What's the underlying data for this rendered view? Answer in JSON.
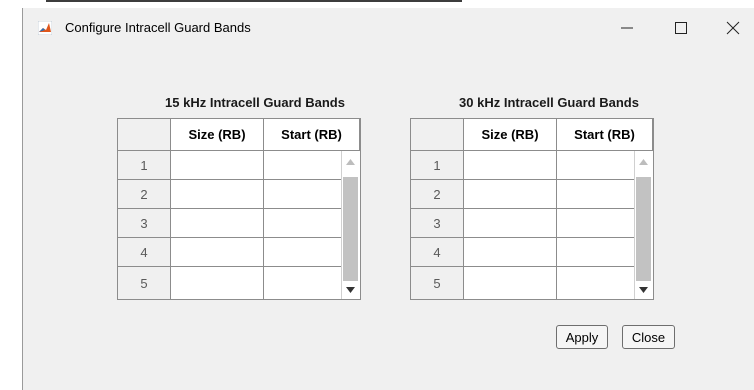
{
  "window": {
    "title": "Configure Intracell Guard Bands",
    "controls": {
      "minimize": "—",
      "maximize": "☐",
      "close": "✕"
    }
  },
  "tables": [
    {
      "title": "15 kHz Intracell Guard Bands",
      "columns": [
        "",
        "Size (RB)",
        "Start (RB)"
      ],
      "rows": [
        {
          "index": "1",
          "size": "",
          "start": ""
        },
        {
          "index": "2",
          "size": "",
          "start": ""
        },
        {
          "index": "3",
          "size": "",
          "start": ""
        },
        {
          "index": "4",
          "size": "",
          "start": ""
        },
        {
          "index": "5",
          "size": "",
          "start": ""
        }
      ]
    },
    {
      "title": "30 kHz Intracell Guard Bands",
      "columns": [
        "",
        "Size (RB)",
        "Start (RB)"
      ],
      "rows": [
        {
          "index": "1",
          "size": "",
          "start": ""
        },
        {
          "index": "2",
          "size": "",
          "start": ""
        },
        {
          "index": "3",
          "size": "",
          "start": ""
        },
        {
          "index": "4",
          "size": "",
          "start": ""
        },
        {
          "index": "5",
          "size": "",
          "start": ""
        }
      ]
    }
  ],
  "buttons": {
    "apply": "Apply",
    "close": "Close"
  },
  "icons": {
    "app": "matlab-icon",
    "scroll_up": "scroll-up-arrow-icon",
    "scroll_down": "scroll-down-arrow-icon"
  },
  "colors": {
    "window_bg": "#f0f0f0",
    "grid_border": "#8c8c8c",
    "scroll_thumb": "#c2c2c2"
  }
}
